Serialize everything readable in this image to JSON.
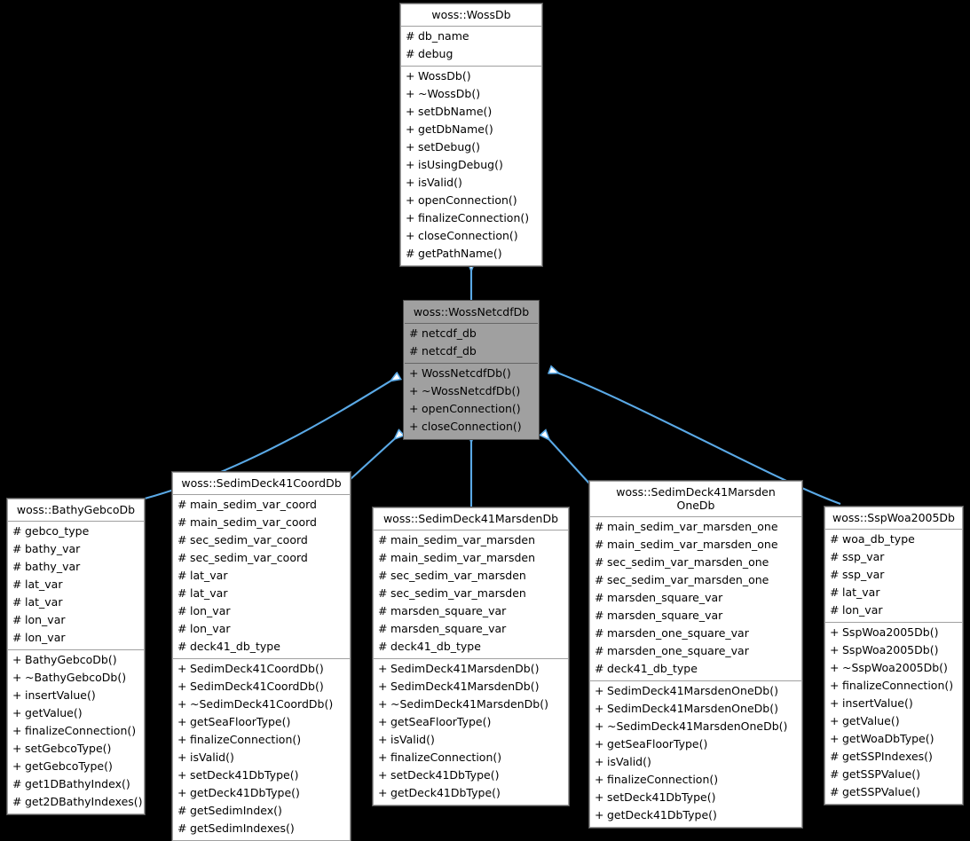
{
  "diagram": {
    "type": "uml-class-inheritance",
    "background": "#000000",
    "edge_color": "#5aa9e6",
    "highlight_color": "#a0a0a0",
    "box_fill": "#ffffff",
    "border_color": "#a0a0a0"
  },
  "classes": {
    "wossdb": {
      "title": "woss::WossDb",
      "attributes": [
        {
          "vis": "#",
          "name": "db_name"
        },
        {
          "vis": "#",
          "name": "debug"
        }
      ],
      "methods": [
        {
          "vis": "+",
          "name": "WossDb()"
        },
        {
          "vis": "+",
          "name": "~WossDb()"
        },
        {
          "vis": "+",
          "name": "setDbName()"
        },
        {
          "vis": "+",
          "name": "getDbName()"
        },
        {
          "vis": "+",
          "name": "setDebug()"
        },
        {
          "vis": "+",
          "name": "isUsingDebug()"
        },
        {
          "vis": "+",
          "name": "isValid()"
        },
        {
          "vis": "+",
          "name": "openConnection()"
        },
        {
          "vis": "+",
          "name": "finalizeConnection()"
        },
        {
          "vis": "+",
          "name": "closeConnection()"
        },
        {
          "vis": "#",
          "name": "getPathName()"
        }
      ]
    },
    "wossnetcdfdb": {
      "title": "woss::WossNetcdfDb",
      "attributes": [
        {
          "vis": "#",
          "name": "netcdf_db"
        },
        {
          "vis": "#",
          "name": "netcdf_db"
        }
      ],
      "methods": [
        {
          "vis": "+",
          "name": "WossNetcdfDb()"
        },
        {
          "vis": "+",
          "name": "~WossNetcdfDb()"
        },
        {
          "vis": "+",
          "name": "openConnection()"
        },
        {
          "vis": "+",
          "name": "closeConnection()"
        }
      ]
    },
    "bathygebcodb": {
      "title": "woss::BathyGebcoDb",
      "attributes": [
        {
          "vis": "#",
          "name": "gebco_type"
        },
        {
          "vis": "#",
          "name": "bathy_var"
        },
        {
          "vis": "#",
          "name": "bathy_var"
        },
        {
          "vis": "#",
          "name": "lat_var"
        },
        {
          "vis": "#",
          "name": "lat_var"
        },
        {
          "vis": "#",
          "name": "lon_var"
        },
        {
          "vis": "#",
          "name": "lon_var"
        }
      ],
      "methods": [
        {
          "vis": "+",
          "name": "BathyGebcoDb()"
        },
        {
          "vis": "+",
          "name": "~BathyGebcoDb()"
        },
        {
          "vis": "+",
          "name": "insertValue()"
        },
        {
          "vis": "+",
          "name": "getValue()"
        },
        {
          "vis": "+",
          "name": "finalizeConnection()"
        },
        {
          "vis": "+",
          "name": "setGebcoType()"
        },
        {
          "vis": "+",
          "name": "getGebcoType()"
        },
        {
          "vis": "#",
          "name": "get1DBathyIndex()"
        },
        {
          "vis": "#",
          "name": "get2DBathyIndexes()"
        }
      ]
    },
    "sedimdeck41coorddb": {
      "title": "woss::SedimDeck41CoordDb",
      "attributes": [
        {
          "vis": "#",
          "name": "main_sedim_var_coord"
        },
        {
          "vis": "#",
          "name": "main_sedim_var_coord"
        },
        {
          "vis": "#",
          "name": "sec_sedim_var_coord"
        },
        {
          "vis": "#",
          "name": "sec_sedim_var_coord"
        },
        {
          "vis": "#",
          "name": "lat_var"
        },
        {
          "vis": "#",
          "name": "lat_var"
        },
        {
          "vis": "#",
          "name": "lon_var"
        },
        {
          "vis": "#",
          "name": "lon_var"
        },
        {
          "vis": "#",
          "name": "deck41_db_type"
        }
      ],
      "methods": [
        {
          "vis": "+",
          "name": "SedimDeck41CoordDb()"
        },
        {
          "vis": "+",
          "name": "SedimDeck41CoordDb()"
        },
        {
          "vis": "+",
          "name": "~SedimDeck41CoordDb()"
        },
        {
          "vis": "+",
          "name": "getSeaFloorType()"
        },
        {
          "vis": "+",
          "name": "finalizeConnection()"
        },
        {
          "vis": "+",
          "name": "isValid()"
        },
        {
          "vis": "+",
          "name": "setDeck41DbType()"
        },
        {
          "vis": "+",
          "name": "getDeck41DbType()"
        },
        {
          "vis": "#",
          "name": "getSedimIndex()"
        },
        {
          "vis": "#",
          "name": "getSedimIndexes()"
        }
      ]
    },
    "sedimdeck41marsdendb": {
      "title": "woss::SedimDeck41MarsdenDb",
      "attributes": [
        {
          "vis": "#",
          "name": "main_sedim_var_marsden"
        },
        {
          "vis": "#",
          "name": "main_sedim_var_marsden"
        },
        {
          "vis": "#",
          "name": "sec_sedim_var_marsden"
        },
        {
          "vis": "#",
          "name": "sec_sedim_var_marsden"
        },
        {
          "vis": "#",
          "name": "marsden_square_var"
        },
        {
          "vis": "#",
          "name": "marsden_square_var"
        },
        {
          "vis": "#",
          "name": "deck41_db_type"
        }
      ],
      "methods": [
        {
          "vis": "+",
          "name": "SedimDeck41MarsdenDb()"
        },
        {
          "vis": "+",
          "name": "SedimDeck41MarsdenDb()"
        },
        {
          "vis": "+",
          "name": "~SedimDeck41MarsdenDb()"
        },
        {
          "vis": "+",
          "name": "getSeaFloorType()"
        },
        {
          "vis": "+",
          "name": "isValid()"
        },
        {
          "vis": "+",
          "name": "finalizeConnection()"
        },
        {
          "vis": "+",
          "name": "setDeck41DbType()"
        },
        {
          "vis": "+",
          "name": "getDeck41DbType()"
        }
      ]
    },
    "sedimdeck41marsdenonedb": {
      "title": "woss::SedimDeck41Marsden\nOneDb",
      "attributes": [
        {
          "vis": "#",
          "name": "main_sedim_var_marsden_one"
        },
        {
          "vis": "#",
          "name": "main_sedim_var_marsden_one"
        },
        {
          "vis": "#",
          "name": "sec_sedim_var_marsden_one"
        },
        {
          "vis": "#",
          "name": "sec_sedim_var_marsden_one"
        },
        {
          "vis": "#",
          "name": "marsden_square_var"
        },
        {
          "vis": "#",
          "name": "marsden_square_var"
        },
        {
          "vis": "#",
          "name": "marsden_one_square_var"
        },
        {
          "vis": "#",
          "name": "marsden_one_square_var"
        },
        {
          "vis": "#",
          "name": "deck41_db_type"
        }
      ],
      "methods": [
        {
          "vis": "+",
          "name": "SedimDeck41MarsdenOneDb()"
        },
        {
          "vis": "+",
          "name": "SedimDeck41MarsdenOneDb()"
        },
        {
          "vis": "+",
          "name": "~SedimDeck41MarsdenOneDb()"
        },
        {
          "vis": "+",
          "name": "getSeaFloorType()"
        },
        {
          "vis": "+",
          "name": "isValid()"
        },
        {
          "vis": "+",
          "name": "finalizeConnection()"
        },
        {
          "vis": "+",
          "name": "setDeck41DbType()"
        },
        {
          "vis": "+",
          "name": "getDeck41DbType()"
        }
      ]
    },
    "sspwoa2005db": {
      "title": "woss::SspWoa2005Db",
      "attributes": [
        {
          "vis": "#",
          "name": "woa_db_type"
        },
        {
          "vis": "#",
          "name": "ssp_var"
        },
        {
          "vis": "#",
          "name": "ssp_var"
        },
        {
          "vis": "#",
          "name": "lat_var"
        },
        {
          "vis": "#",
          "name": "lon_var"
        }
      ],
      "methods": [
        {
          "vis": "+",
          "name": "SspWoa2005Db()"
        },
        {
          "vis": "+",
          "name": "SspWoa2005Db()"
        },
        {
          "vis": "+",
          "name": "~SspWoa2005Db()"
        },
        {
          "vis": "+",
          "name": "finalizeConnection()"
        },
        {
          "vis": "+",
          "name": "insertValue()"
        },
        {
          "vis": "+",
          "name": "getValue()"
        },
        {
          "vis": "+",
          "name": "getWoaDbType()"
        },
        {
          "vis": "#",
          "name": "getSSPIndexes()"
        },
        {
          "vis": "#",
          "name": "getSSPValue()"
        },
        {
          "vis": "#",
          "name": "getSSPValue()"
        }
      ]
    }
  },
  "edges": [
    {
      "from": "wossnetcdfdb",
      "to": "wossdb",
      "kind": "inheritance"
    },
    {
      "from": "bathygebcodb",
      "to": "wossnetcdfdb",
      "kind": "inheritance"
    },
    {
      "from": "sedimdeck41coorddb",
      "to": "wossnetcdfdb",
      "kind": "inheritance"
    },
    {
      "from": "sedimdeck41marsdendb",
      "to": "wossnetcdfdb",
      "kind": "inheritance"
    },
    {
      "from": "sedimdeck41marsdenonedb",
      "to": "wossnetcdfdb",
      "kind": "inheritance"
    },
    {
      "from": "sspwoa2005db",
      "to": "wossnetcdfdb",
      "kind": "inheritance"
    }
  ]
}
